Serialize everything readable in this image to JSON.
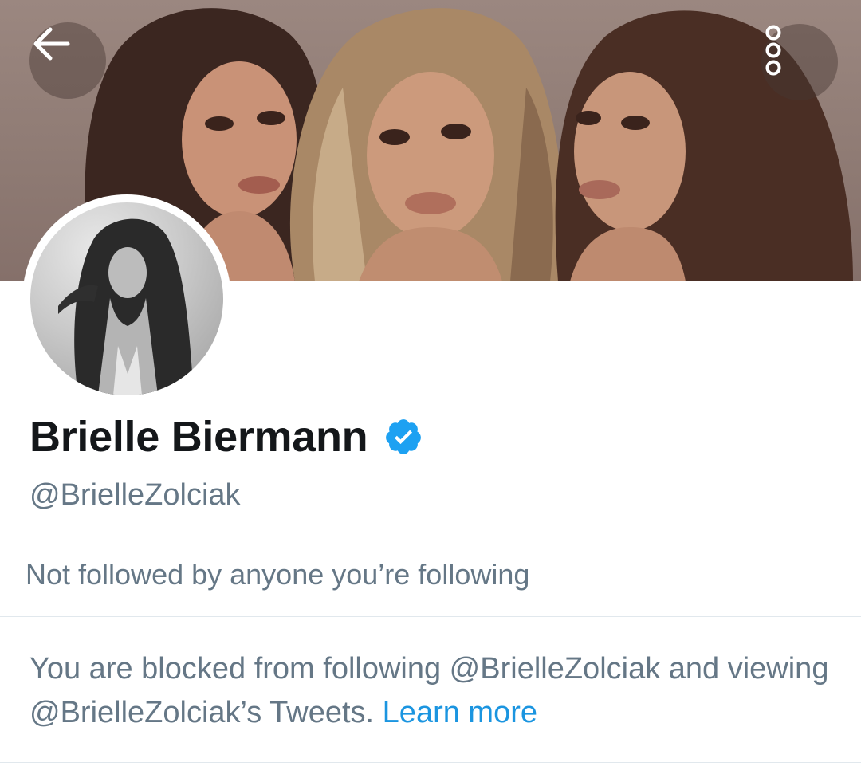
{
  "header": {
    "banner_image": "three-women-portrait-banner",
    "back_icon": "arrow-left-icon",
    "more_icon": "more-vertical-icon"
  },
  "profile": {
    "avatar_image": "black-and-white-portrait-avatar",
    "display_name": "Brielle Biermann",
    "verified_icon": "verified-badge-icon",
    "handle": "@BrielleZolciak",
    "followed_by_text": "Not followed by anyone you’re following"
  },
  "blocked_notice": {
    "text": "You are blocked from following @BrielleZolciak and viewing @BrielleZolciak’s Tweets.",
    "link_label": "Learn more"
  },
  "colors": {
    "text_primary": "#14171a",
    "text_secondary": "#657786",
    "link": "#1b95e0",
    "verified": "#1da1f2",
    "divider": "#e1e8ed"
  }
}
